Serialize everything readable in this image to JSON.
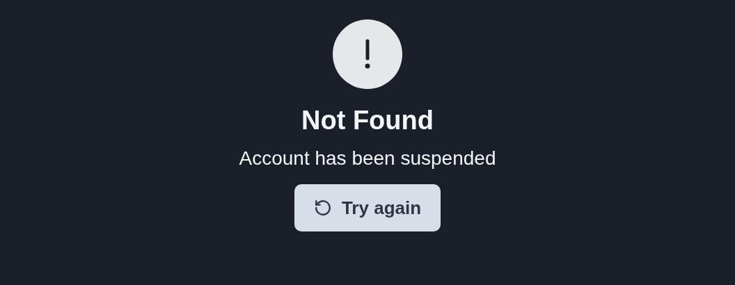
{
  "title": "Not Found",
  "message": "Account has been suspended",
  "button": {
    "label": "Try again"
  }
}
